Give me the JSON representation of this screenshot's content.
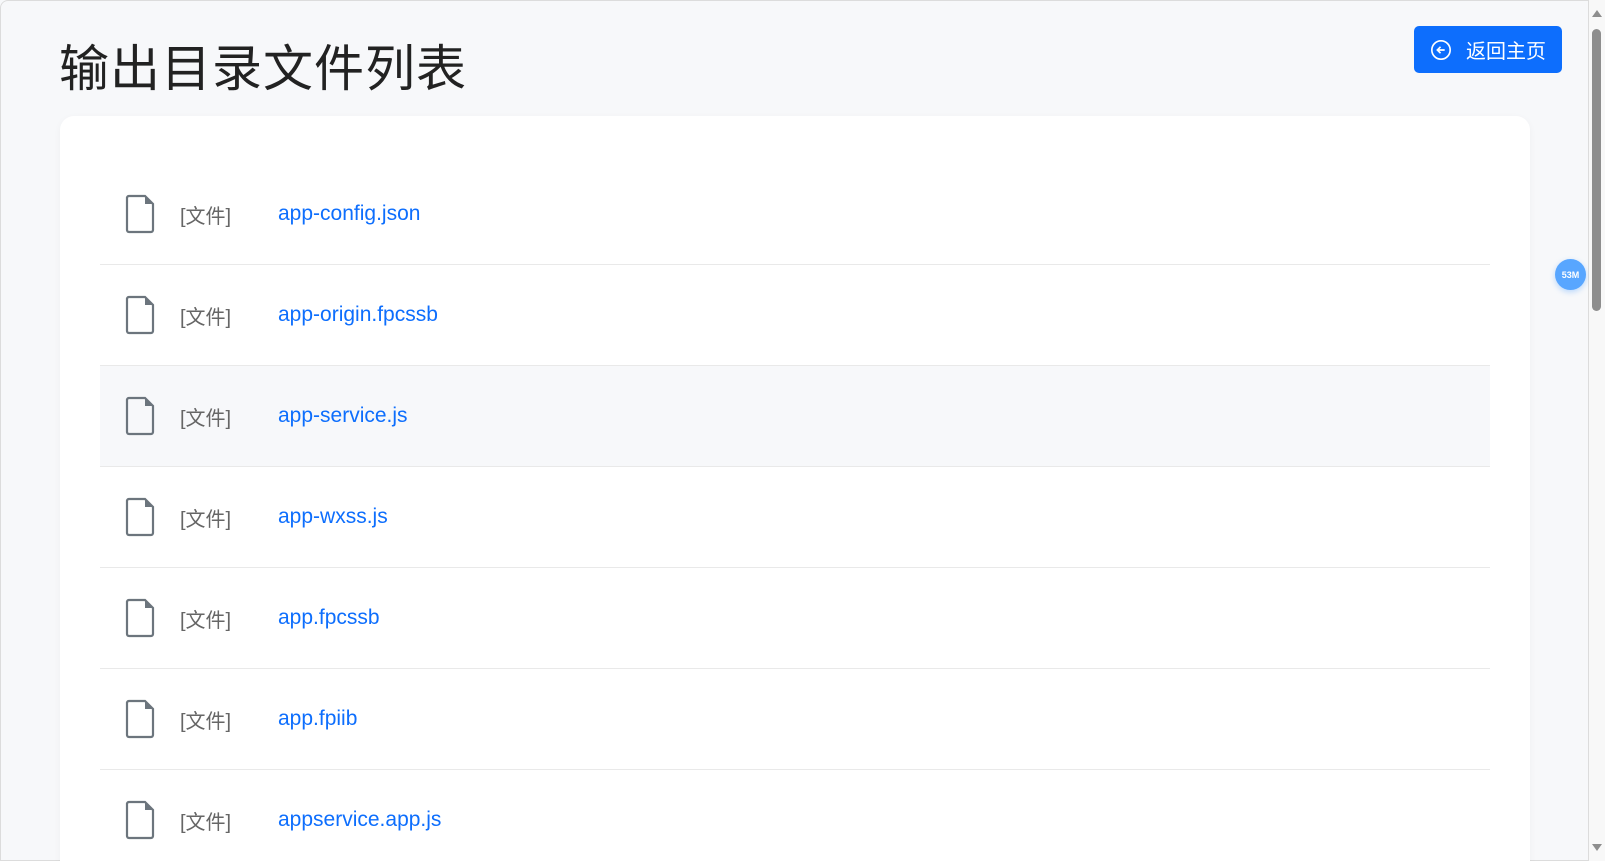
{
  "header": {
    "title": "输出目录文件列表",
    "back_label": "返回主页"
  },
  "badge": "53M",
  "files": [
    {
      "type": "[文件]",
      "name": "app-config.json"
    },
    {
      "type": "[文件]",
      "name": "app-origin.fpcssb"
    },
    {
      "type": "[文件]",
      "name": "app-service.js"
    },
    {
      "type": "[文件]",
      "name": "app-wxss.js"
    },
    {
      "type": "[文件]",
      "name": "app.fpcssb"
    },
    {
      "type": "[文件]",
      "name": "app.fpiib"
    },
    {
      "type": "[文件]",
      "name": "appservice.app.js"
    }
  ]
}
